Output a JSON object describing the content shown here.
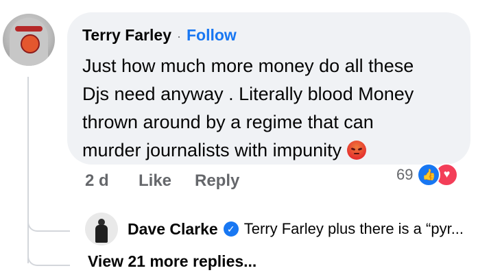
{
  "comment": {
    "author": "Terry Farley",
    "separator": "·",
    "follow_label": "Follow",
    "lines": [
      "Just how much more  money do all these",
      "Djs need anyway . Literally blood Money",
      "thrown around by a regime that can",
      "murder journalists with impunity"
    ],
    "trailing_emoji": "angry-face-emoji",
    "time": "2 d",
    "like_label": "Like",
    "reply_label": "Reply",
    "reaction_count": "69",
    "reactions": [
      "like-reaction-icon",
      "love-reaction-icon"
    ]
  },
  "reply": {
    "author": "Dave Clarke",
    "verified_icon": "verified-badge-icon",
    "preview": "Terry Farley plus there is a “pyr..."
  },
  "view_more_label": "View 21 more replies...",
  "colors": {
    "accent": "#1877f2",
    "bubble": "#f0f2f5",
    "muted": "#65676b",
    "love": "#f33e58"
  }
}
